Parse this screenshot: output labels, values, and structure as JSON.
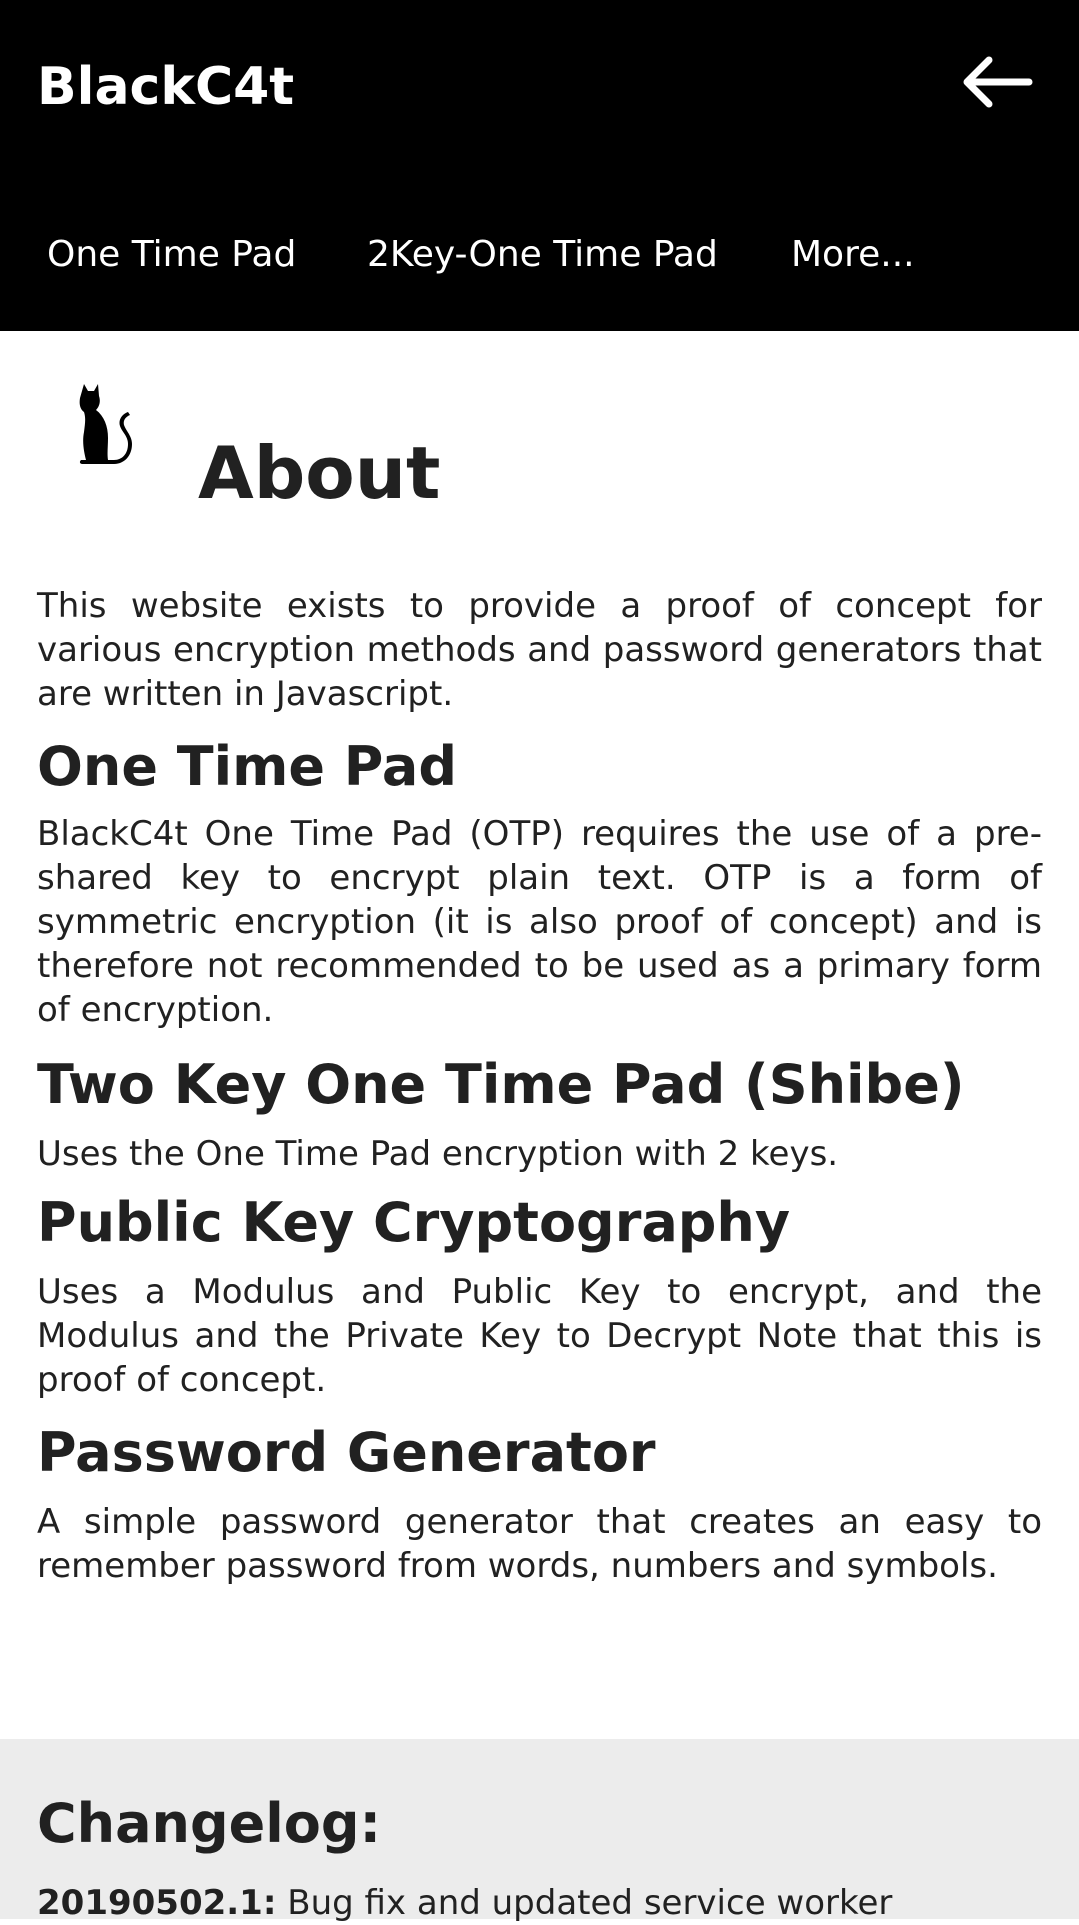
{
  "appbar": {
    "brand": "BlackC4t",
    "back_icon": "arrow-left-icon",
    "tabs": [
      {
        "label": "One Time Pad"
      },
      {
        "label": "2Key-One Time Pad"
      },
      {
        "label": "More..."
      }
    ]
  },
  "about": {
    "icon": "cat-icon",
    "title": "About",
    "intro": "This website exists to provide a proof of concept for various encryption methods and password generators that are written in Javascript."
  },
  "sections": [
    {
      "title": "One Time Pad",
      "body": "BlackC4t One Time Pad (OTP) requires the use of a pre-shared key to encrypt plain text. OTP is a form of symmetric encryption (it is also proof of concept) and is therefore not recommended to be used as a primary form of encryption."
    },
    {
      "title": "Two Key One Time Pad (Shibe)",
      "body": "Uses the One Time Pad encryption with 2 keys."
    },
    {
      "title": "Public Key Cryptography",
      "body": "Uses a Modulus and Public Key to encrypt, and the Modulus and the Private Key to Decrypt Note that this is proof of concept."
    },
    {
      "title": "Password Generator",
      "body": "A simple password generator that creates an easy to remember password from words, numbers and symbols."
    }
  ],
  "changelog": {
    "title": "Changelog:",
    "entries": [
      {
        "version": "20190502.1:",
        "text": "Bug fix and updated service worker"
      }
    ]
  },
  "colors": {
    "appbar_bg": "#000000",
    "appbar_text": "#ffffff",
    "body_text": "#212121",
    "changelog_bg": "#ececec"
  }
}
